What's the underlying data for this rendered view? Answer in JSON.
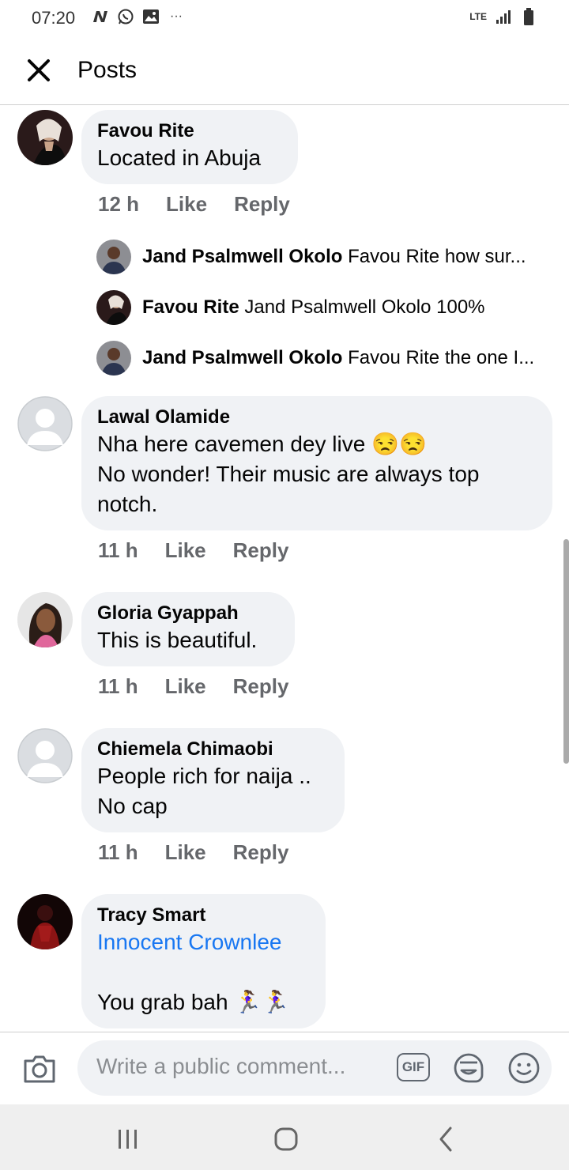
{
  "status_bar": {
    "time": "07:20",
    "more": "···",
    "network": "LTE"
  },
  "header": {
    "title": "Posts"
  },
  "comments": [
    {
      "author": "Favou Rite",
      "text": "Located in Abuja",
      "time": "12 h",
      "like": "Like",
      "reply": "Reply",
      "replies": [
        {
          "author": "Jand Psalmwell Okolo",
          "text": "Favou Rite how sur..."
        },
        {
          "author": "Favou Rite",
          "text": "Jand Psalmwell Okolo 100%"
        },
        {
          "author": "Jand Psalmwell Okolo",
          "text": "Favou Rite the one I..."
        }
      ]
    },
    {
      "author": "Lawal Olamide",
      "text": "Nha here cavemen dey live 😒😒\nNo wonder! Their music are always top notch.",
      "time": "11 h",
      "like": "Like",
      "reply": "Reply"
    },
    {
      "author": "Gloria Gyappah",
      "text": "This is beautiful.",
      "time": "11 h",
      "like": "Like",
      "reply": "Reply"
    },
    {
      "author": "Chiemela Chimaobi",
      "text": "People rich for naija ..\nNo cap",
      "time": "11 h",
      "like": "Like",
      "reply": "Reply"
    },
    {
      "author": "Tracy Smart",
      "mention": "Innocent Crownlee",
      "text": "You grab bah 🏃‍♀️🏃‍♀️"
    }
  ],
  "composer": {
    "placeholder": "Write a public comment...",
    "gif": "GIF"
  },
  "icons": {
    "close": "close-icon",
    "camera": "camera-icon",
    "sticker": "sticker-icon",
    "emoji": "smiley-icon",
    "nav_recents": "recents-icon",
    "nav_home": "home-icon",
    "nav_back": "back-icon"
  },
  "colors": {
    "link": "#1877f2",
    "bubble": "#f0f2f5",
    "meta": "#65676b"
  }
}
